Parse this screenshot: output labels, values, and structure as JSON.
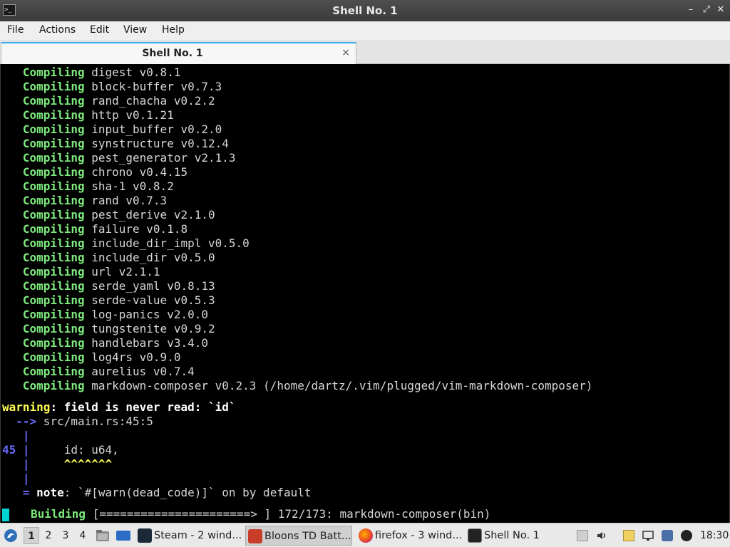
{
  "window": {
    "title": "Shell No. 1"
  },
  "menu": [
    "File",
    "Actions",
    "Edit",
    "View",
    "Help"
  ],
  "tab": {
    "label": "Shell No. 1",
    "close": "×"
  },
  "compile_keyword": "Compiling",
  "crates": [
    "digest v0.8.1",
    "block-buffer v0.7.3",
    "rand_chacha v0.2.2",
    "http v0.1.21",
    "input_buffer v0.2.0",
    "synstructure v0.12.4",
    "pest_generator v2.1.3",
    "chrono v0.4.15",
    "sha-1 v0.8.2",
    "rand v0.7.3",
    "pest_derive v2.1.0",
    "failure v0.1.8",
    "include_dir_impl v0.5.0",
    "include_dir v0.5.0",
    "url v2.1.1",
    "serde_yaml v0.8.13",
    "serde-value v0.5.3",
    "log-panics v2.0.0",
    "tungstenite v0.9.2",
    "handlebars v3.4.0",
    "log4rs v0.9.0",
    "aurelius v0.7.4",
    "markdown-composer v0.2.3 (/home/dartz/.vim/plugged/vim-markdown-composer)"
  ],
  "warning": {
    "label": "warning",
    "message": ": field is never read: `id`",
    "arrow": "  -->",
    "location": " src/main.rs:45:5",
    "pipe": "   |",
    "line_no": "45",
    "code": "     id: u64,",
    "carets": "^^^^^^^",
    "note_eq": "   =",
    "note_label": "note",
    "note_text": ": `#[warn(dead_code)]` on by default"
  },
  "build": {
    "label": "Building",
    "progress": "[======================> ] 172/173: markdown-composer(bin)",
    "fraction": 0.994
  },
  "taskbar": {
    "workspaces": [
      "1",
      "2",
      "3",
      "4"
    ],
    "active_workspace": "1",
    "tasks": [
      {
        "label": "Steam - 2 wind...",
        "icon": "steam-icon"
      },
      {
        "label": "Bloons TD Batt...",
        "icon": "bloons-icon"
      },
      {
        "label": "firefox - 3 wind...",
        "icon": "firefox-icon"
      },
      {
        "label": "Shell No. 1",
        "icon": "terminal-icon"
      }
    ],
    "clock": "18:30"
  }
}
